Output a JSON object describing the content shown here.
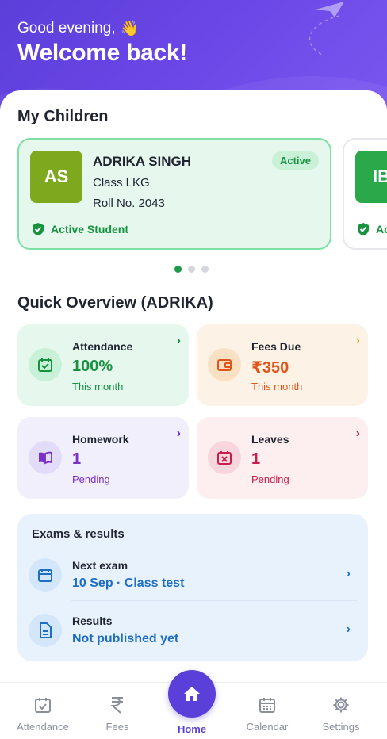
{
  "header": {
    "greeting": "Good evening,",
    "greeting_emoji": "👋",
    "welcome": "Welcome back!"
  },
  "children_section": {
    "title": "My Children",
    "cards": [
      {
        "initials": "AS",
        "name": "ADRIKA SINGH",
        "class": "Class LKG",
        "roll": "Roll No. 2043",
        "badge": "Active",
        "status": "Active Student",
        "avatar_color": "#7ea91e"
      },
      {
        "initials": "IB",
        "status": "Active Student",
        "avatar_color": "#2aa84a"
      }
    ],
    "carousel_active_index": 0,
    "carousel_count": 3
  },
  "overview": {
    "title": "Quick Overview (ADRIKA)",
    "tiles": [
      {
        "label": "Attendance",
        "value": "100%",
        "sub": "This month",
        "icon": "calendar-check-icon",
        "accent": "#17923f",
        "bg": "#e6f8ee"
      },
      {
        "label": "Fees Due",
        "value": "₹350",
        "sub": "This month",
        "icon": "wallet-icon",
        "accent": "#e0561a",
        "bg": "#fdf2e6"
      },
      {
        "label": "Homework",
        "value": "1",
        "sub": "Pending",
        "icon": "book-icon",
        "accent": "#7a2fc8",
        "bg": "#f2effc"
      },
      {
        "label": "Leaves",
        "value": "1",
        "sub": "Pending",
        "icon": "calendar-x-icon",
        "accent": "#c81e4a",
        "bg": "#fdeef0"
      }
    ]
  },
  "exams": {
    "title": "Exams & results",
    "rows": [
      {
        "label": "Next exam",
        "value": "10 Sep · Class test",
        "icon": "calendar-icon"
      },
      {
        "label": "Results",
        "value": "Not published yet",
        "icon": "document-icon"
      }
    ]
  },
  "nav": {
    "items": [
      {
        "label": "Attendance",
        "icon": "calendar-check-icon"
      },
      {
        "label": "Fees",
        "icon": "rupee-icon"
      },
      {
        "label": "Home",
        "icon": "home-icon"
      },
      {
        "label": "Calendar",
        "icon": "calendar-grid-icon"
      },
      {
        "label": "Settings",
        "icon": "gear-icon"
      }
    ],
    "active": "Home"
  },
  "colors": {
    "brand": "#5b3fd9",
    "success": "#17923f",
    "link": "#1e6fc4"
  }
}
